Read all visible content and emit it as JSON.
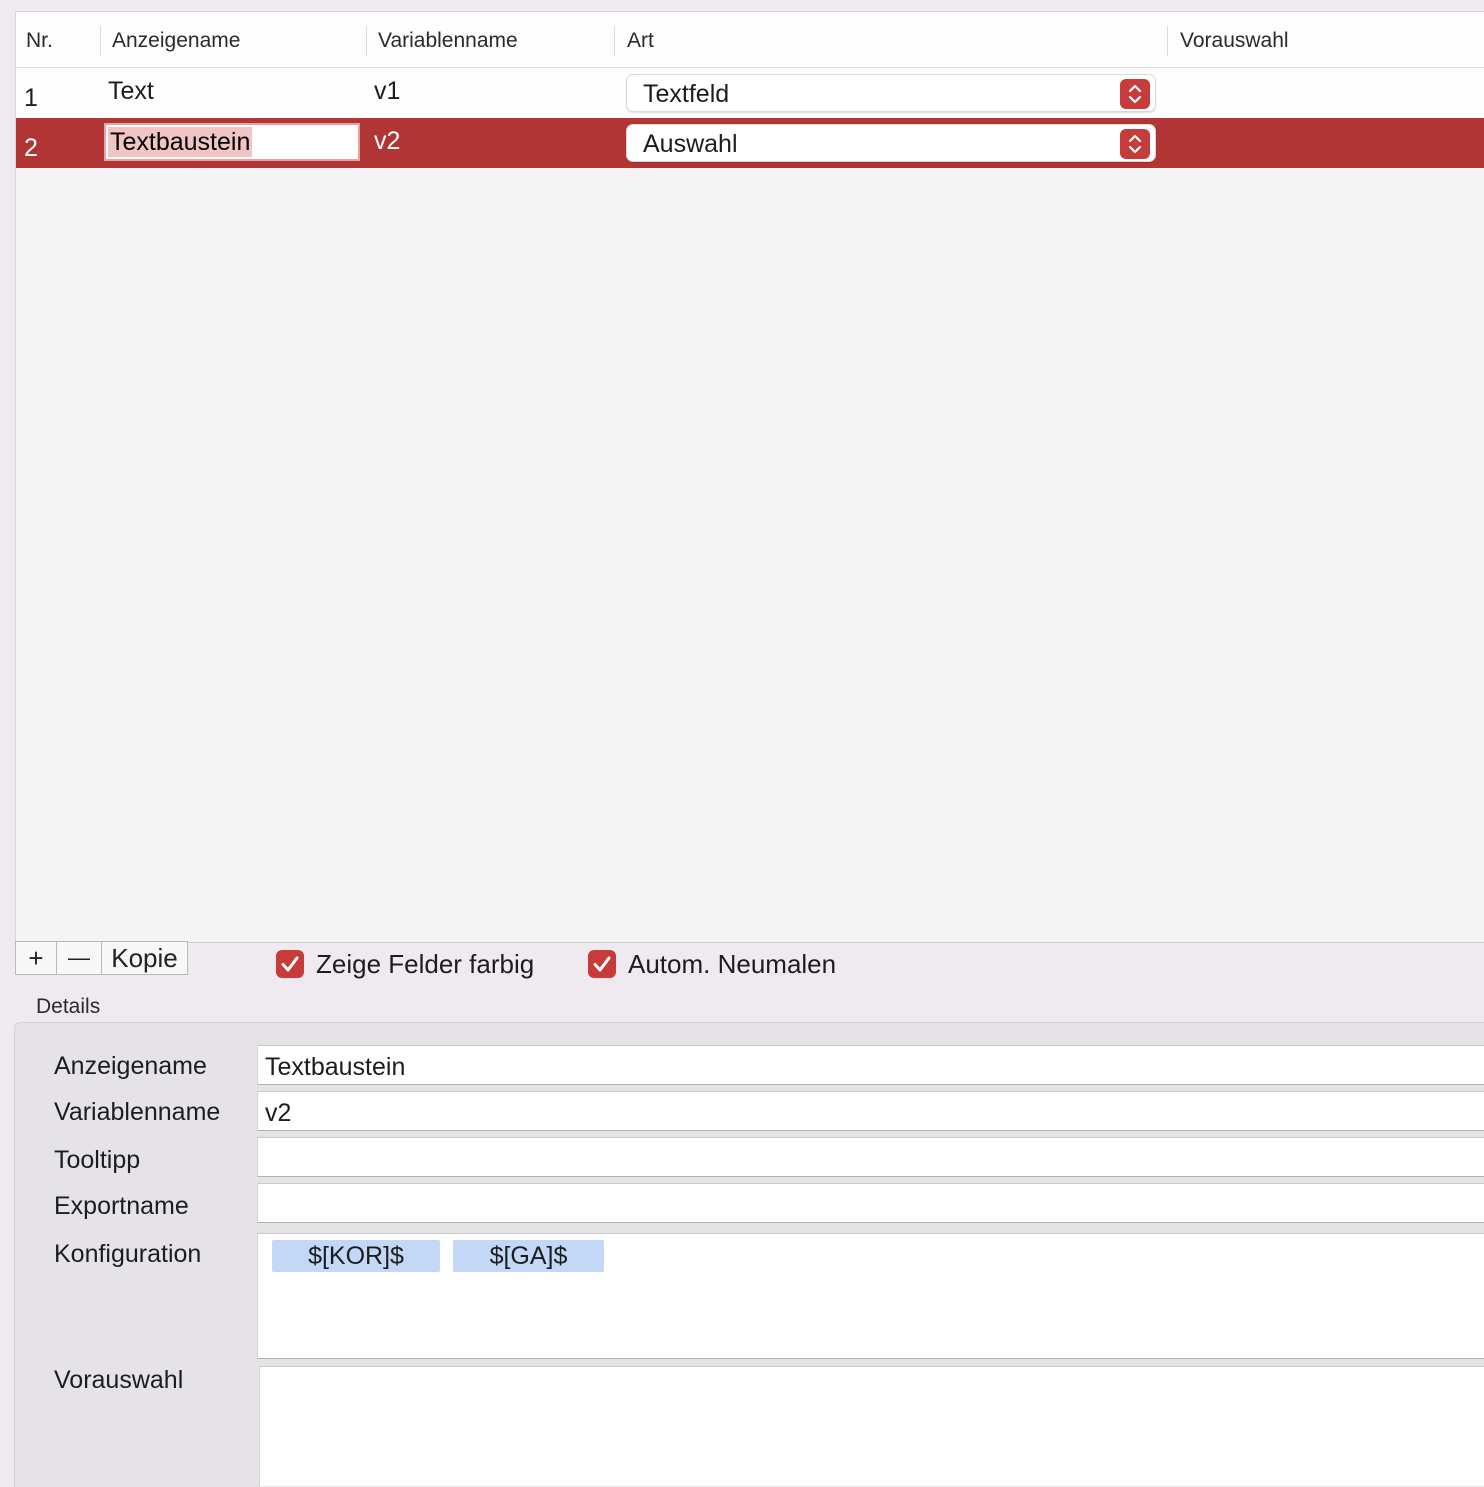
{
  "table": {
    "columns": [
      "Nr.",
      "Anzeigename",
      "Variablenname",
      "Art",
      "Vorauswahl"
    ],
    "rows": [
      {
        "nr": "1",
        "anzeigename": "Text",
        "variablenname": "v1",
        "art": "Textfeld",
        "vorauswahl": ""
      },
      {
        "nr": "2",
        "anzeigename": "Textbaustein",
        "variablenname": "v2",
        "art": "Auswahl",
        "vorauswahl": "",
        "selected": true
      }
    ]
  },
  "toolbar": {
    "add_label": "+",
    "remove_label": "—",
    "copy_label": "Kopie",
    "show_colored_label": "Zeige Felder farbig",
    "show_colored_checked": true,
    "auto_repaint_label": "Autom. Neumalen",
    "auto_repaint_checked": true
  },
  "details": {
    "title": "Details",
    "labels": {
      "anzeigename": "Anzeigename",
      "variablenname": "Variablenname",
      "tooltipp": "Tooltipp",
      "exportname": "Exportname",
      "konfiguration": "Konfiguration",
      "vorauswahl": "Vorauswahl"
    },
    "values": {
      "anzeigename": "Textbaustein",
      "variablenname": "v2",
      "tooltipp": "",
      "exportname": "",
      "vorauswahl": ""
    },
    "tokens": [
      "$[KOR]$",
      "$[GA]$"
    ]
  },
  "colors": {
    "accent": "#c73b3b",
    "selected_row": "#b23535",
    "token_bg": "#c2d8f6"
  },
  "icons": {
    "stepper": "chevron-up-down-icon",
    "checkbox": "checkmark-icon"
  }
}
